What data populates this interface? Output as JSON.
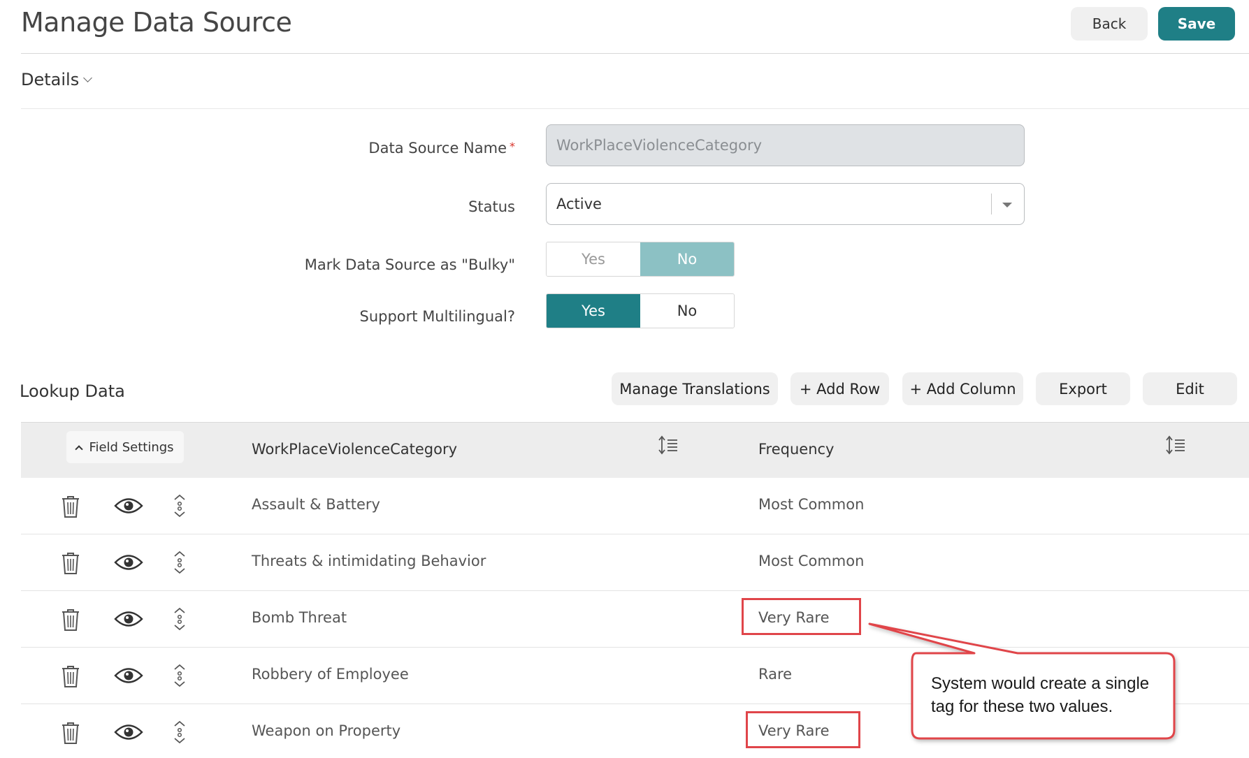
{
  "header": {
    "title": "Manage Data Source",
    "back_label": "Back",
    "save_label": "Save"
  },
  "details": {
    "label": "Details"
  },
  "form": {
    "data_source_name": {
      "label": "Data Source Name",
      "required_mark": "*",
      "value": "WorkPlaceViolenceCategory"
    },
    "status": {
      "label": "Status",
      "value": "Active"
    },
    "bulky": {
      "label": "Mark Data Source as \"Bulky\"",
      "yes": "Yes",
      "no": "No",
      "selected": "No"
    },
    "multilingual": {
      "label": "Support Multilingual?",
      "yes": "Yes",
      "no": "No",
      "selected": "Yes"
    }
  },
  "lookup": {
    "title": "Lookup Data",
    "buttons": {
      "manage_translations": "Manage Translations",
      "add_row": "+ Add Row",
      "add_column": "+ Add Column",
      "export": "Export",
      "edit": "Edit"
    },
    "field_settings_label": "Field Settings",
    "columns": [
      "WorkPlaceViolenceCategory",
      "Frequency"
    ],
    "rows": [
      {
        "category": "Assault & Battery",
        "frequency": "Most Common"
      },
      {
        "category": "Threats & intimidating Behavior",
        "frequency": "Most Common"
      },
      {
        "category": "Bomb Threat",
        "frequency": "Very Rare"
      },
      {
        "category": "Robbery of Employee",
        "frequency": "Rare"
      },
      {
        "category": "Weapon on Property",
        "frequency": "Very Rare"
      }
    ]
  },
  "annotation": {
    "text": "System would create a single tag for these two values.",
    "color": "#e0454a"
  },
  "colors": {
    "accent": "#1f7f86",
    "accent_light": "#8cc1c4"
  }
}
